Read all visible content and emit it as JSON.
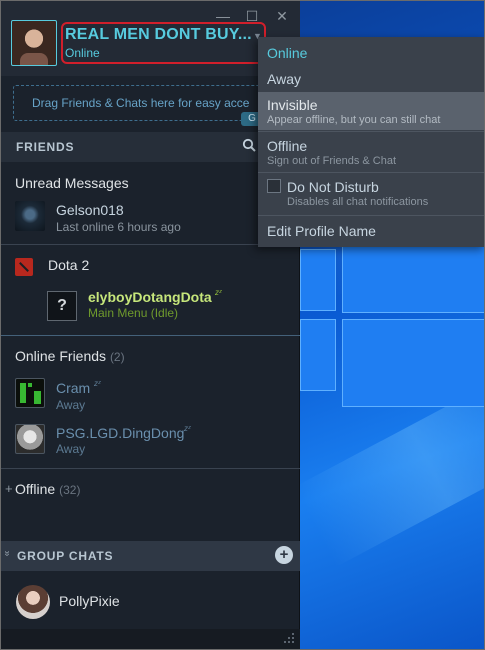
{
  "profile": {
    "username": "REAL MEN DONT BUY...",
    "status": "Online"
  },
  "window_controls": {
    "minimize": "—",
    "maximize": "☐",
    "close": "✕"
  },
  "dropzone": {
    "text": "Drag Friends & Chats here for easy acce",
    "badge": "G"
  },
  "friends": {
    "header": "FRIENDS",
    "unread": {
      "title": "Unread Messages",
      "items": [
        {
          "name": "Gelson018",
          "status": "Last online 6 hours ago"
        }
      ]
    },
    "game_group": {
      "title": "Dota 2",
      "items": [
        {
          "name": "elyboyDotangDota",
          "status": "Main Menu (Idle)",
          "avatar_char": "?",
          "zz": "zᶻ"
        }
      ]
    },
    "online": {
      "title": "Online Friends",
      "count": "(2)",
      "items": [
        {
          "name": "Cram",
          "status": "Away",
          "zz": "zᶻ"
        },
        {
          "name": "PSG.LGD.DingDong",
          "status": "Away",
          "zz": "zᶻ"
        }
      ]
    },
    "offline": {
      "prefix": "+",
      "title": "Offline",
      "count": "(32)"
    }
  },
  "group_chats": {
    "header": "GROUP CHATS",
    "chevron": "»",
    "add": "+",
    "items": [
      {
        "name": "PollyPixie"
      }
    ]
  },
  "status_menu": {
    "items": [
      {
        "label": "Online"
      },
      {
        "label": "Away"
      },
      {
        "label": "Invisible",
        "desc": "Appear offline, but you can still chat"
      },
      {
        "label": "Offline",
        "desc": "Sign out of Friends & Chat"
      },
      {
        "label": "Do Not Disturb",
        "desc": "Disables all chat notifications"
      },
      {
        "label": "Edit Profile Name"
      }
    ]
  },
  "colors": {
    "accent": "#57cbde",
    "in_game": "#90ba3c",
    "highlight_box": "#d11f2b"
  }
}
